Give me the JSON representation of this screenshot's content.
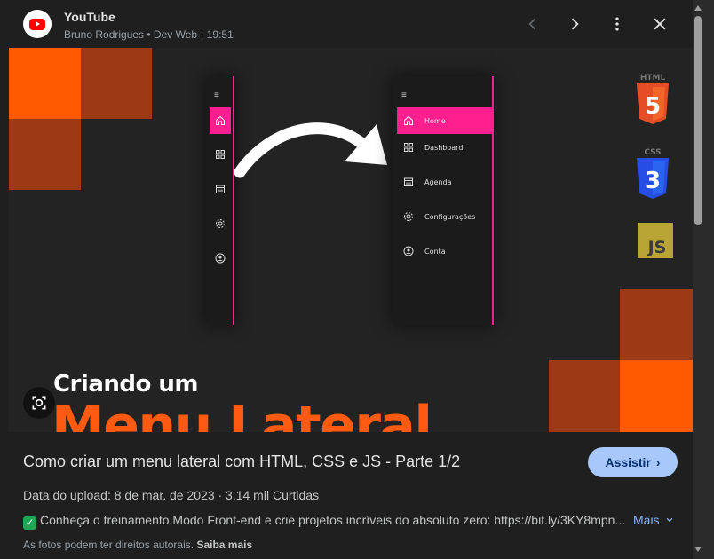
{
  "colors": {
    "background": "#1f1f1f",
    "brand_red": "#ff0000",
    "accent_orange": "#ff5a12",
    "accent_pink": "#ff1f8f",
    "button_blue": "#a8c7fa",
    "link_blue": "#8ab4f8"
  },
  "header": {
    "site": "YouTube",
    "meta": "Bruno Rodrigues • Dev Web · 19:51",
    "icons": [
      "youtube-logo",
      "chevron-left-icon",
      "chevron-right-icon",
      "more-vert-icon",
      "close-icon"
    ]
  },
  "thumbnail": {
    "line1": "Criando um",
    "line2": "Menu Lateral",
    "mock_menu": {
      "items": [
        {
          "icon": "home-icon",
          "label": "Home",
          "active": true
        },
        {
          "icon": "dashboard-icon",
          "label": "Dashboard",
          "active": false
        },
        {
          "icon": "calendar-icon",
          "label": "Agenda",
          "active": false
        },
        {
          "icon": "gear-icon",
          "label": "Configurações",
          "active": false
        },
        {
          "icon": "account-icon",
          "label": "Conta",
          "active": false
        }
      ]
    },
    "badges": [
      {
        "name": "html5-badge",
        "text": "HTML",
        "num": "5",
        "color": "#e44d26"
      },
      {
        "name": "css3-badge",
        "text": "CSS",
        "num": "3",
        "color": "#264de4"
      },
      {
        "name": "js-badge",
        "text": "JS",
        "color": "#f0db4f"
      }
    ]
  },
  "details": {
    "title": "Como criar um menu lateral com HTML, CSS e JS - Parte 1/2",
    "watch_label": "Assistir",
    "upload": "Data do upload: 8 de mar. de 2023  ·  3,14 mil Curtidas",
    "description": "Conheça o treinamento Modo Front-end e crie projetos incríveis do absoluto zero: https://bit.ly/3KY8mpn...",
    "more_label": "Mais",
    "copyright_text": "As fotos podem ter direitos autorais.",
    "learn_more": "Saiba mais"
  }
}
